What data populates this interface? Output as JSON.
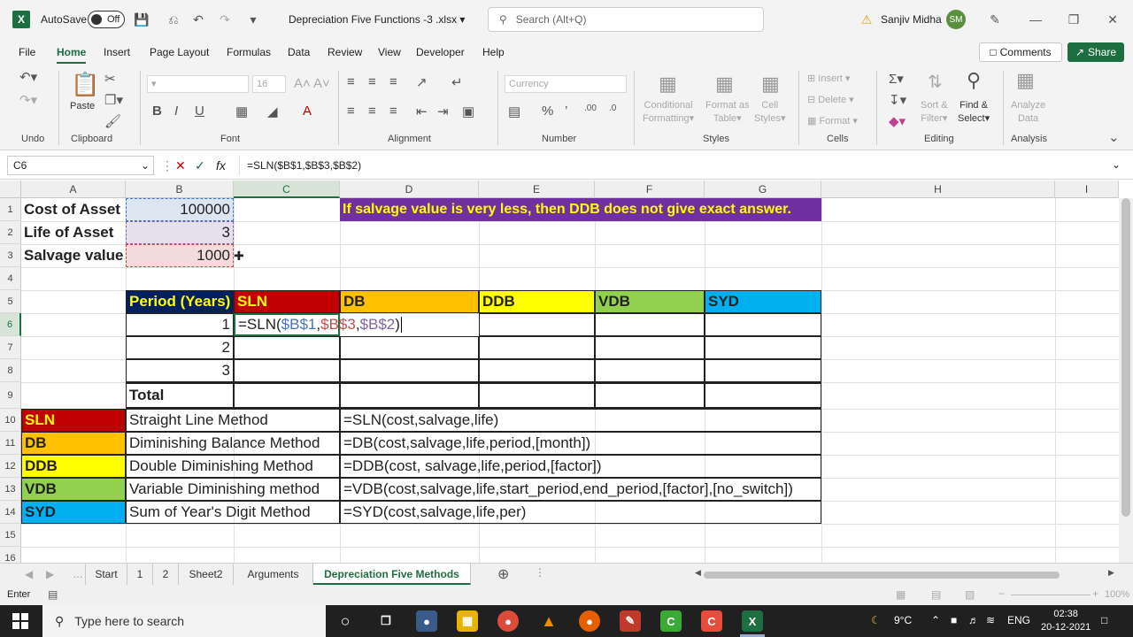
{
  "titlebar": {
    "autosave_label": "AutoSave",
    "autosave_state": "Off",
    "filename": "Depreciation Five Functions -3 .xlsx",
    "search_placeholder": "Search (Alt+Q)",
    "user_name": "Sanjiv Midha",
    "user_initials": "SM"
  },
  "menu": {
    "items": [
      "File",
      "Home",
      "Insert",
      "Page Layout",
      "Formulas",
      "Data",
      "Review",
      "View",
      "Developer",
      "Help"
    ],
    "comments": "Comments",
    "share": "Share"
  },
  "ribbon": {
    "groups": [
      "Undo",
      "Clipboard",
      "Font",
      "Alignment",
      "Number",
      "Styles",
      "Cells",
      "Editing",
      "Analysis"
    ],
    "paste": "Paste",
    "font_size": "16",
    "number_format": "Currency",
    "conditional_formatting": [
      "Conditional",
      "Formatting"
    ],
    "format_as_table": [
      "Format as",
      "Table"
    ],
    "cell_styles": [
      "Cell",
      "Styles"
    ],
    "insert": "Insert",
    "delete": "Delete",
    "format": "Format",
    "sort_filter": [
      "Sort &",
      "Filter"
    ],
    "find_select": [
      "Find &",
      "Select"
    ],
    "analyze_data": [
      "Analyze",
      "Data"
    ]
  },
  "formula_bar": {
    "name_box": "C6",
    "formula": "=SLN($B$1,$B$3,$B$2)"
  },
  "columns": [
    "A",
    "B",
    "C",
    "D",
    "E",
    "F",
    "G",
    "H",
    "I"
  ],
  "rows": [
    "1",
    "2",
    "3",
    "4",
    "5",
    "6",
    "7",
    "8",
    "9",
    "10",
    "11",
    "12",
    "13",
    "14",
    "15",
    "16"
  ],
  "cells": {
    "a1": "Cost of Asset",
    "b1": "100000",
    "a2": "Life of Asset",
    "b2": "3",
    "a3": "Salvage value",
    "b3": "1000",
    "note": "If salvage value is very less, then DDB does not give exact answer.",
    "period_header": "Period (Years)",
    "sln_header": "SLN",
    "db_header": "DB",
    "ddb_header": "DDB",
    "vdb_header": "VDB",
    "syd_header": "SYD",
    "p1": "1",
    "p2": "2",
    "p3": "3",
    "total": "Total",
    "edit_prefix": "=SLN(",
    "edit_ref1": "$B$1",
    "edit_ref2": "$B$3",
    "edit_ref3": "$B$2",
    "edit_suffix": ")"
  },
  "methods": [
    {
      "code": "SLN",
      "name": "Straight Line Method",
      "syntax": "=SLN(cost,salvage,life)"
    },
    {
      "code": "DB",
      "name": "Diminishing Balance Method",
      "syntax": "=DB(cost,salvage,life,period,[month])"
    },
    {
      "code": "DDB",
      "name": "Double Diminishing Method",
      "syntax": "=DDB(cost, salvage,life,period,[factor])"
    },
    {
      "code": "VDB",
      "name": "Variable Diminishing method",
      "syntax": "=VDB(cost,salvage,life,start_period,end_period,[factor],[no_switch])"
    },
    {
      "code": "SYD",
      "name": "Sum of Year's Digit Method",
      "syntax": "=SYD(cost,salvage,life,per)"
    }
  ],
  "colors": {
    "sln": "#c00000",
    "db": "#ffc000",
    "ddb": "#ffff00",
    "vdb": "#92d050",
    "syd": "#00b0f0",
    "period_header_bg": "#002060",
    "period_header_fg": "#ffff00",
    "note_bg": "#7030a0",
    "note_fg": "#ffff00",
    "ref1": "#4472c4",
    "ref2": "#c0504d",
    "ref3": "#8064a2"
  },
  "sheet_tabs": [
    "Start",
    "1",
    "2",
    "Sheet2",
    "Arguments",
    "Depreciation Five Methods"
  ],
  "status": {
    "mode": "Enter",
    "zoom": "100%"
  },
  "taskbar": {
    "search_placeholder": "Type here to search",
    "temperature": "9°C",
    "language": "ENG",
    "time": "02:38",
    "date": "20-12-2021"
  }
}
